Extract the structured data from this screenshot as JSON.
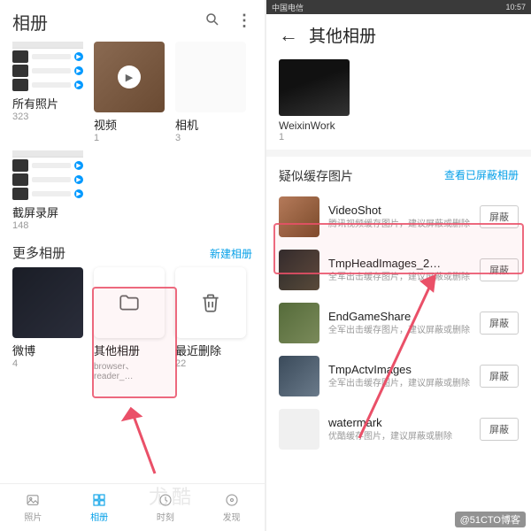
{
  "left": {
    "header": {
      "title": "相册"
    },
    "row1": [
      {
        "label": "所有照片",
        "count": "323"
      },
      {
        "label": "视频",
        "count": "1"
      },
      {
        "label": "相机",
        "count": "3"
      }
    ],
    "row2": [
      {
        "label": "截屏录屏",
        "count": "148"
      }
    ],
    "more_albums": {
      "title": "更多相册",
      "link": "新建相册"
    },
    "row3": [
      {
        "label": "微博",
        "count": "4"
      },
      {
        "label": "其他相册",
        "sub": "browser、reader_…"
      },
      {
        "label": "最近删除",
        "count": "22"
      }
    ],
    "nav": [
      {
        "label": "照片"
      },
      {
        "label": "相册"
      },
      {
        "label": "时刻"
      },
      {
        "label": "发现"
      }
    ]
  },
  "right": {
    "status": {
      "left": "中国电信",
      "right": "10:57"
    },
    "header": {
      "title": "其他相册"
    },
    "album": {
      "label": "WeixinWork",
      "count": "1"
    },
    "cache": {
      "title": "疑似缓存图片",
      "link": "查看已屏蔽相册",
      "btn": "屏蔽",
      "items": [
        {
          "name": "VideoShot",
          "desc": "腾讯视频缓存图片，建议屏蔽或删除"
        },
        {
          "name": "TmpHeadImages_2…",
          "desc": "全军出击缓存图片，建议屏蔽或删除"
        },
        {
          "name": "EndGameShare",
          "desc": "全军出击缓存图片，建议屏蔽或删除"
        },
        {
          "name": "TmpActvImages",
          "desc": "全军出击缓存图片，建议屏蔽或删除"
        },
        {
          "name": "watermark",
          "desc": "优酷缓存图片，建议屏蔽或删除"
        }
      ]
    }
  },
  "overlay": {
    "watermark": "尤酷",
    "footer": "@51CTO博客"
  }
}
